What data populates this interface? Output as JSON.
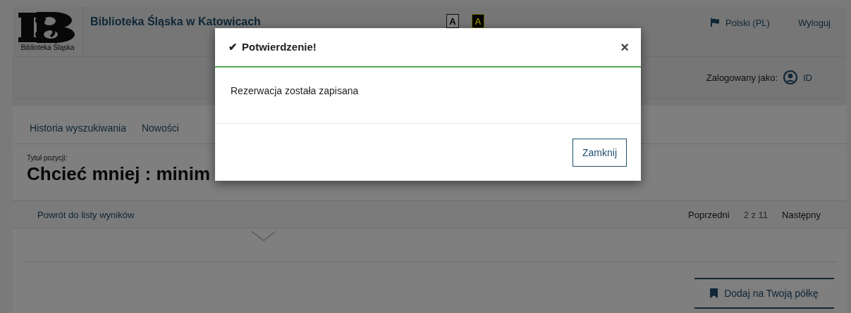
{
  "header": {
    "logo_caption": "Biblioteka Śląska",
    "site_title": "Biblioteka Śląska w Katowicach",
    "contrast_buttons": [
      {
        "label": "A",
        "kind": "normal"
      },
      {
        "label": "A",
        "kind": "high"
      }
    ],
    "language": "Polski (PL)",
    "logout": "Wyloguj",
    "logged_in_label": "Zalogowany jako:",
    "user": "ID"
  },
  "nav": [
    {
      "label": "Historia wyszukiwania"
    },
    {
      "label": "Nowości"
    }
  ],
  "record": {
    "title_label": "Tytuł pozycji:",
    "title": "Chcieć mniej : minim"
  },
  "results_nav": {
    "back": "Powrót do listy wyników",
    "previous": "Poprzedni",
    "position": "2 z 11",
    "next": "Następny"
  },
  "shelf_button": "Dodaj na Twoją półkę",
  "modal": {
    "title_icon": "✔",
    "title": "Potwierdzenie!",
    "close": "×",
    "message": "Rezerwacja została zapisana",
    "close_button": "Zamknij"
  }
}
